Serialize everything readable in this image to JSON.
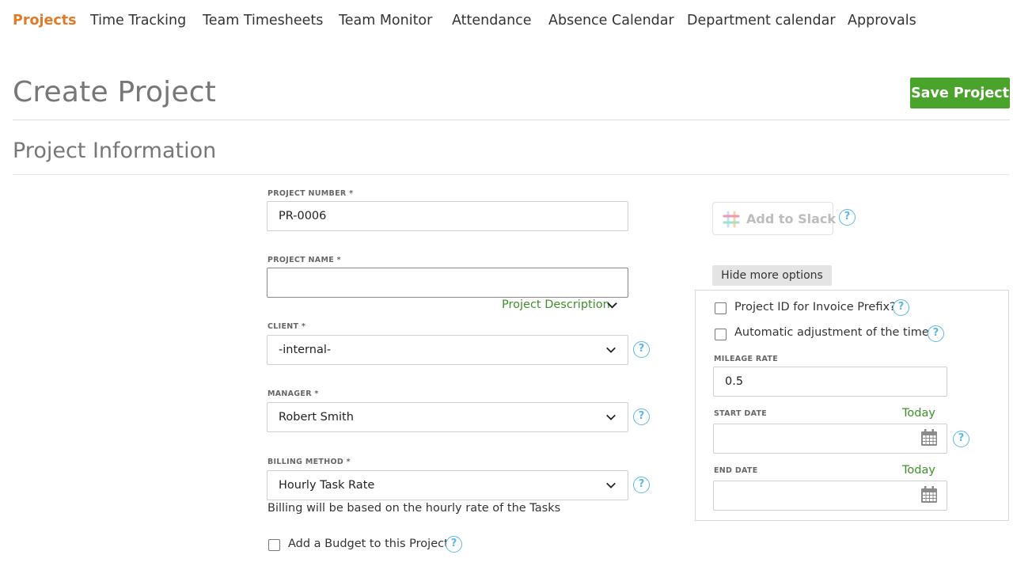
{
  "nav": {
    "items": [
      {
        "label": "Projects",
        "active": true
      },
      {
        "label": "Time Tracking"
      },
      {
        "label": "Team Timesheets"
      },
      {
        "label": "Team Monitor"
      },
      {
        "label": "Attendance"
      },
      {
        "label": "Absence Calendar"
      },
      {
        "label": "Department calendar"
      },
      {
        "label": "Approvals"
      }
    ]
  },
  "header": {
    "title": "Create Project",
    "save_label": "Save Project"
  },
  "section": {
    "title": "Project Information"
  },
  "form": {
    "project_number": {
      "label": "PROJECT NUMBER *",
      "value": "PR-0006"
    },
    "project_name": {
      "label": "PROJECT NAME *",
      "value": ""
    },
    "project_description_link": "Project Description",
    "client": {
      "label": "CLIENT *",
      "value": "-internal-"
    },
    "manager": {
      "label": "MANAGER *",
      "value": "Robert Smith"
    },
    "billing_method": {
      "label": "BILLING METHOD *",
      "value": "Hourly Task Rate",
      "note": "Billing will be based on the hourly rate of the Tasks"
    },
    "budget_checkbox": {
      "label": "Add a Budget to this Project",
      "checked": false
    }
  },
  "side": {
    "slack_label": "Add to Slack",
    "hide_options_label": "Hide more options",
    "invoice_prefix": {
      "label": "Project ID for Invoice Prefix?",
      "checked": false
    },
    "auto_adjust": {
      "label": "Automatic adjustment of the time?",
      "checked": false
    },
    "mileage_rate": {
      "label": "MILEAGE RATE",
      "value": "0.5"
    },
    "start_date": {
      "label": "START DATE",
      "today_label": "Today",
      "value": ""
    },
    "end_date": {
      "label": "END DATE",
      "today_label": "Today",
      "value": ""
    }
  },
  "colors": {
    "accent_orange": "#e07b2a",
    "save_green": "#4aa32b",
    "link_green": "#3e8f2a",
    "help_blue": "#5bb8e6"
  },
  "icons": {
    "help": "question-circle-icon",
    "chevron": "chevron-down-icon",
    "calendar": "calendar-icon",
    "slack": "slack-logo-icon"
  }
}
